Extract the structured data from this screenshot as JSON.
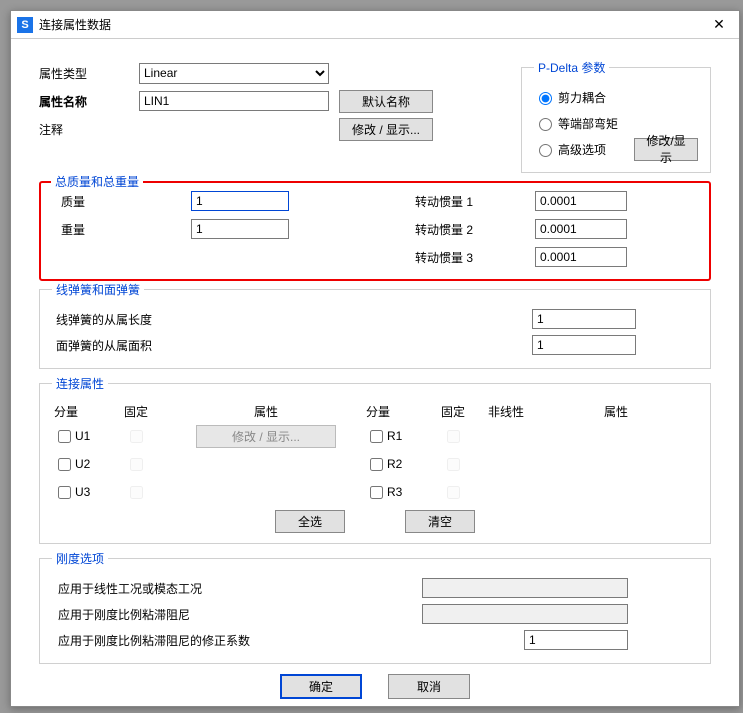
{
  "window": {
    "title": "连接属性数据"
  },
  "top": {
    "attrType_label": "属性类型",
    "attrType_value": "Linear",
    "attrName_label": "属性名称",
    "attrName_value": "LIN1",
    "defaultName_btn": "默认名称",
    "notes_label": "注释",
    "notes_btn": "修改 / 显示..."
  },
  "pdelta": {
    "legend": "P-Delta 参数",
    "opt1": "剪力耦合",
    "opt2": "等端部弯矩",
    "opt3": "高级选项",
    "modify_btn": "修改/显示"
  },
  "mass": {
    "legend": "总质量和总重量",
    "mass_label": "质量",
    "mass_value": "1",
    "weight_label": "重量",
    "weight_value": "1",
    "rot1_label": "转动惯量 1",
    "rot1_value": "0.0001",
    "rot2_label": "转动惯量 2",
    "rot2_value": "0.0001",
    "rot3_label": "转动惯量 3",
    "rot3_value": "0.0001"
  },
  "spring": {
    "legend": "线弹簧和面弹簧",
    "line_label": "线弹簧的从属长度",
    "line_value": "1",
    "area_label": "面弹簧的从属面积",
    "area_value": "1"
  },
  "dof": {
    "legend": "连接属性",
    "hdr_comp": "分量",
    "hdr_fix": "固定",
    "hdr_prop": "属性",
    "hdr_nl": "非线性",
    "u1": "U1",
    "u2": "U2",
    "u3": "U3",
    "r1": "R1",
    "r2": "R2",
    "r3": "R3",
    "modify_btn": "修改 / 显示...",
    "all_btn": "全选",
    "clear_btn": "清空"
  },
  "stiff": {
    "legend": "刚度选项",
    "row1_label": "应用于线性工况或模态工况",
    "row2_label": "应用于刚度比例粘滞阻尼",
    "row3_label": "应用于刚度比例粘滞阻尼的修正系数",
    "row3_value": "1"
  },
  "footer": {
    "ok": "确定",
    "cancel": "取消"
  }
}
